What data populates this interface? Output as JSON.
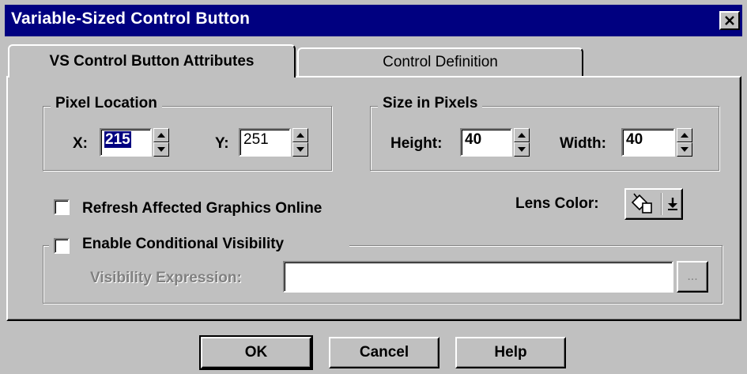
{
  "window": {
    "title": "Variable-Sized Control Button",
    "close_glyph": "✕"
  },
  "tabs": [
    {
      "label": "VS Control Button Attributes",
      "active": true
    },
    {
      "label": "Control Definition",
      "active": false
    }
  ],
  "pixel_location": {
    "legend": "Pixel Location",
    "x_label": "X:",
    "x_value": "215",
    "y_label": "Y:",
    "y_value": "251"
  },
  "size_in_pixels": {
    "legend": "Size in Pixels",
    "height_label": "Height:",
    "height_value": "40",
    "width_label": "Width:",
    "width_value": "40"
  },
  "refresh": {
    "label": "Refresh Affected Graphics Online",
    "checked": false
  },
  "lens_color": {
    "label": "Lens Color:",
    "icon": "paint-bucket-icon",
    "dropdown_icon": "dropdown-arrow-icon"
  },
  "conditional_visibility": {
    "label": "Enable Conditional Visibility",
    "checked": false,
    "expression_label": "Visibility Expression:",
    "expression_value": "",
    "browse_label": "..."
  },
  "buttons": {
    "ok": "OK",
    "cancel": "Cancel",
    "help": "Help"
  },
  "colors": {
    "titlebar": "#000080",
    "face": "#c0c0c0",
    "disabled_text": "#808080"
  }
}
